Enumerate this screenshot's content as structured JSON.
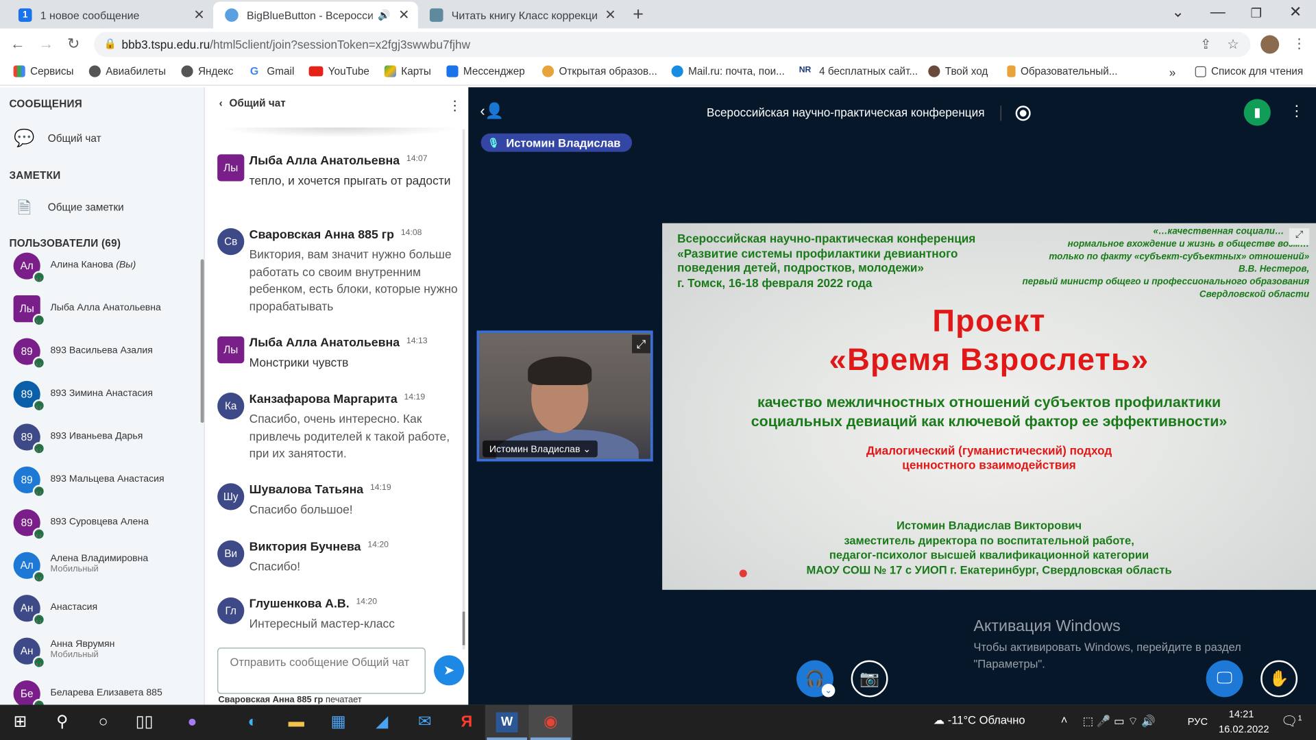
{
  "browser": {
    "tabs": [
      {
        "title": "1 новое сообщение",
        "badge": "1"
      },
      {
        "title": "BigBlueButton - Всероссийская"
      },
      {
        "title": "Читать книгу Класс коррекции"
      }
    ],
    "url_host": "bbb3.tspu.edu.ru",
    "url_path": "/html5client/join?sessionToken=x2fgj3swwbu7fjhw",
    "bookmarks": [
      "Сервисы",
      "Авиабилеты",
      "Яндекс",
      "Gmail",
      "YouTube",
      "Карты",
      "Мессенджер",
      "Открытая образов...",
      "Mail.ru: почта, пои...",
      "4 бесплатных сайт...",
      "Твой ход",
      "Образовательный...",
      "Список для чтения"
    ],
    "bookmarks_more": "»"
  },
  "sidebar": {
    "messages_title": "СООБЩЕНИЯ",
    "public_chat": "Общий чат",
    "notes_title": "ЗАМЕТКИ",
    "shared_notes": "Общие заметки",
    "users_title": "ПОЛЬЗОВАТЕЛИ (69)",
    "users": [
      {
        "initials": "Ал",
        "name": "Алина Канова",
        "suffix": "(Вы)",
        "sub": "",
        "color": "#7a1f8a",
        "square": false
      },
      {
        "initials": "Лы",
        "name": "Лыба Алла Анатольевна",
        "suffix": "",
        "sub": "",
        "color": "#7a1f8a",
        "square": true
      },
      {
        "initials": "89",
        "name": "893 Васильева Азалия",
        "suffix": "",
        "sub": "",
        "color": "#7a1f8a",
        "square": false
      },
      {
        "initials": "89",
        "name": "893 Зимина Анастасия",
        "suffix": "",
        "sub": "",
        "color": "#0b5ea8",
        "square": false
      },
      {
        "initials": "89",
        "name": "893 Иваньева Дарья",
        "suffix": "",
        "sub": "",
        "color": "#3e4a87",
        "square": false
      },
      {
        "initials": "89",
        "name": "893 Мальцева Анастасия",
        "suffix": "",
        "sub": "",
        "color": "#1e78d6",
        "square": false
      },
      {
        "initials": "89",
        "name": "893 Суровцева Алена",
        "suffix": "",
        "sub": "",
        "color": "#7a1f8a",
        "square": false
      },
      {
        "initials": "Ал",
        "name": "Алена Владимировна",
        "suffix": "",
        "sub": "Мобильный",
        "color": "#1e78d6",
        "square": false
      },
      {
        "initials": "Ан",
        "name": "Анастасия",
        "suffix": "",
        "sub": "",
        "color": "#3e4a87",
        "square": false
      },
      {
        "initials": "Ан",
        "name": "Анна Яврумян",
        "suffix": "",
        "sub": "Мобильный",
        "color": "#3e4a87",
        "square": false
      },
      {
        "initials": "Бе",
        "name": "Беларева Елизавета 885",
        "suffix": "",
        "sub": "",
        "color": "#7a1f8a",
        "square": false
      }
    ]
  },
  "chat": {
    "title": "Общий чат",
    "messages": [
      {
        "initials": "Лы",
        "name": "Лыба Алла Анатольевна",
        "time": "14:07",
        "text": "тепло, и хочется прыгать от радости",
        "square": true
      },
      {
        "initials": "Св",
        "name": "Сваровская Анна 885 гр",
        "time": "14:08",
        "text": "Виктория, вам значит нужно больше работать со своим внутренним ребенком, есть блоки, которые нужно прорабатывать",
        "square": false
      },
      {
        "initials": "Лы",
        "name": "Лыба Алла Анатольевна",
        "time": "14:13",
        "text": "Монстрики чувств",
        "square": true
      },
      {
        "initials": "Ка",
        "name": "Канзафарова Маргарита",
        "time": "14:19",
        "text": "Спасибо, очень интересно. Как привлечь родителей к такой работе, при их занятости.",
        "square": false
      },
      {
        "initials": "Шу",
        "name": "Шувалова Татьяна",
        "time": "14:19",
        "text": "Спасибо большое!",
        "square": false
      },
      {
        "initials": "Ви",
        "name": "Виктория Бучнева",
        "time": "14:20",
        "text": "Спасибо!",
        "square": false
      },
      {
        "initials": "Гл",
        "name": "Глушенкова А.В.",
        "time": "14:20",
        "text": "Интересный мастер-класс",
        "square": false
      }
    ],
    "input_placeholder": "Отправить сообщение Общий чат",
    "typing_name": "Сваровская Анна 885 гр",
    "typing_suffix": "печатает"
  },
  "meeting": {
    "title": "Всероссийская научно-практическая конференция",
    "talker": "Истомин Владислав",
    "webcam_label": "Истомин Владислав"
  },
  "slide": {
    "conf_lines": [
      "Всероссийская научно-практическая конференция",
      "«Развитие системы профилактики девиантного",
      "поведения детей, подростков, молодежи»",
      "г. Томск, 16-18 февраля 2022 года"
    ],
    "quote_lines": [
      "«…качественная социали…",
      "нормальное вхождение и жизнь в обществе возм…",
      "только по факту «субъект-субъектных» отношений»",
      "В.В. Нестеров,",
      "первый министр общего и профессионального образования",
      "Свердловской области"
    ],
    "project_line1": "Проект",
    "project_line2": "«Время Взрослеть»",
    "subtitle_lines": [
      "качество межличностных отношений субъектов профилактики",
      "социальных девиаций как ключевой фактор ее эффективности»"
    ],
    "approach_lines": [
      "Диалогический (гуманистический) подход",
      "ценностного взаимодействия"
    ],
    "author_lines": [
      "Истомин Владислав Викторович",
      "заместитель директора по воспитательной работе,",
      "педагог-психолог высшей квалификационной категории",
      "МАОУ СОШ № 17 с УИОП г. Екатеринбург, Свердловская область"
    ]
  },
  "windows_watermark": {
    "title": "Активация Windows",
    "line1": "Чтобы активировать Windows, перейдите в раздел",
    "line2": "\"Параметры\"."
  },
  "taskbar": {
    "weather": "-11°C  Облачно",
    "lang": "РУС",
    "time": "14:21",
    "date": "16.02.2022",
    "notifications": "1"
  }
}
